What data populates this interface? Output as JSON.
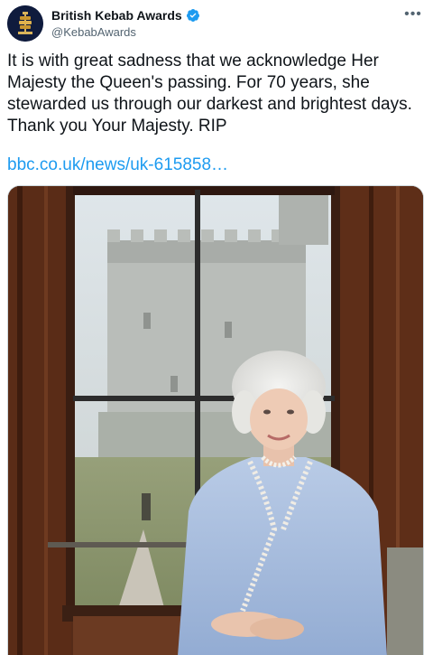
{
  "tweet": {
    "author": {
      "display_name": "British Kebab Awards",
      "handle": "@KebabAwards",
      "verified": true,
      "avatar_icon": "kebab-awards-logo-icon"
    },
    "more_icon": "more-options-icon",
    "text": "It is with great sadness that we acknowledge Her\nMajesty the Queen's passing. For 70 years, she\nstewarded us through our darkest and brightest days.\nThank you Your Majesty. RIP",
    "link_text": "bbc.co.uk/news/uk-615858…",
    "media": {
      "type": "photo",
      "subject": "queen-portrait-at-window"
    }
  },
  "colors": {
    "link": "#1d9bf0",
    "verified": "#1d9bf0",
    "avatar_bg": "#0f1b3d",
    "secondary_text": "#536471"
  }
}
